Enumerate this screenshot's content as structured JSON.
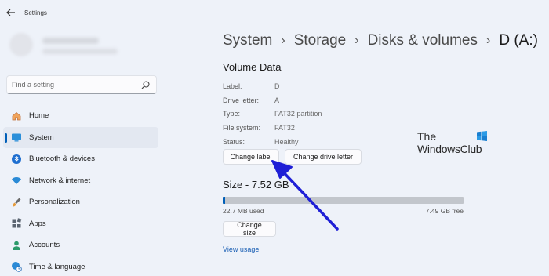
{
  "window": {
    "title": "Settings"
  },
  "search": {
    "placeholder": "Find a setting"
  },
  "sidebar": {
    "items": [
      {
        "label": "Home",
        "icon": "home-icon"
      },
      {
        "label": "System",
        "icon": "system-icon",
        "active": true
      },
      {
        "label": "Bluetooth & devices",
        "icon": "bluetooth-icon"
      },
      {
        "label": "Network & internet",
        "icon": "wifi-icon"
      },
      {
        "label": "Personalization",
        "icon": "brush-icon"
      },
      {
        "label": "Apps",
        "icon": "apps-icon"
      },
      {
        "label": "Accounts",
        "icon": "person-icon"
      },
      {
        "label": "Time & language",
        "icon": "globe-clock-icon"
      }
    ]
  },
  "breadcrumb": [
    "System",
    "Storage",
    "Disks & volumes",
    "D (A:)"
  ],
  "volume": {
    "title": "Volume Data",
    "properties": [
      {
        "key": "Label:",
        "value": "D"
      },
      {
        "key": "Drive letter:",
        "value": "A"
      },
      {
        "key": "Type:",
        "value": "FAT32 partition"
      },
      {
        "key": "File system:",
        "value": "FAT32"
      },
      {
        "key": "Status:",
        "value": "Healthy"
      }
    ],
    "change_label_button": "Change label",
    "change_letter_button": "Change drive letter"
  },
  "size": {
    "title": "Size - 7.52 GB",
    "used": "22.7 MB used",
    "free": "7.49 GB free",
    "used_fraction": 0.003,
    "change_size_button": "Change size",
    "view_usage_link": "View usage"
  },
  "watermark": {
    "line1": "The",
    "line2": "WindowsClub"
  },
  "colors": {
    "accent": "#005fb8",
    "annotation_arrow": "#1f1fd6",
    "background": "#eef2f9"
  }
}
